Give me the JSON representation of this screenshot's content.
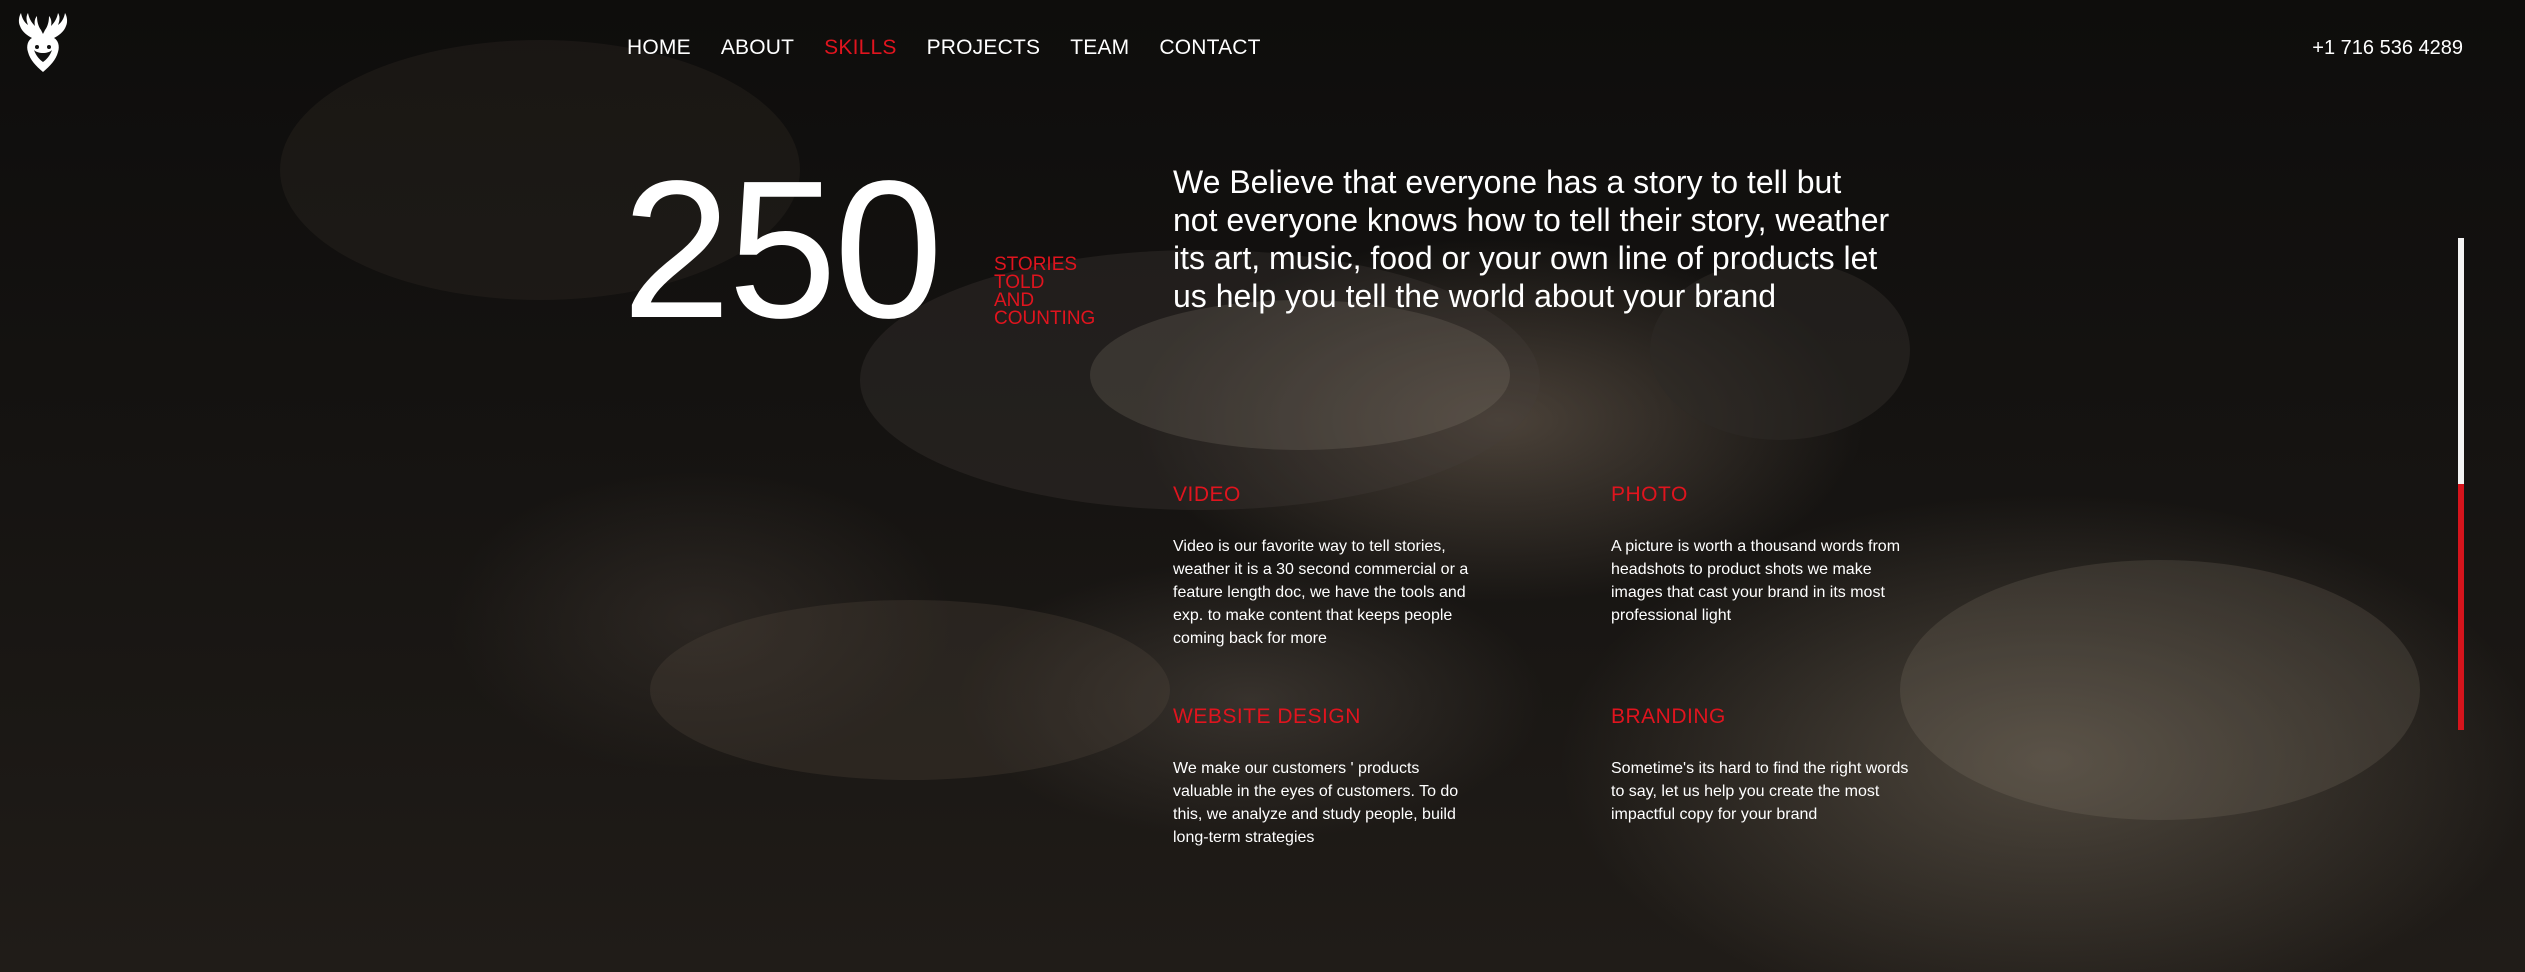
{
  "nav": {
    "items": [
      {
        "label": "HOME"
      },
      {
        "label": "ABOUT"
      },
      {
        "label": "SKILLS"
      },
      {
        "label": "PROJECTS"
      },
      {
        "label": "TEAM"
      },
      {
        "label": "CONTACT"
      }
    ],
    "active": "SKILLS"
  },
  "phone": "+1 716 536 4289",
  "stats": {
    "number": "250",
    "caption_lines": [
      "STORIES",
      "TOLD",
      "AND",
      "COUNTING"
    ]
  },
  "intro": "We Believe that everyone has a story to tell but not everyone knows how to tell their story, weather its art, music, food or your own line of products let us help you tell the world about your brand",
  "skills": [
    {
      "title": "VIDEO",
      "text": "Video is our favorite way to tell stories, weather it is a 30 second commercial or a feature length doc, we have the tools and exp. to make content that keeps people coming back for more"
    },
    {
      "title": "PHOTO",
      "text": "A picture is worth a thousand words from headshots to product shots we make images that cast your brand in its most professional light"
    },
    {
      "title": "WEBSITE DESIGN",
      "text": "We make our customers ' products valuable in the eyes of customers. To do this, we analyze and study people, build long-term strategies"
    },
    {
      "title": "BRANDING",
      "text": "Sometime's its hard to find the right words to say, let us help you create the most impactful copy for your brand"
    }
  ],
  "scroll": {
    "progress": 0.5
  },
  "colors": {
    "accent": "#e0141e",
    "text": "#ffffff",
    "background": "#0b0a09"
  },
  "icons": {
    "logo": "deer-antler-logo-icon"
  }
}
